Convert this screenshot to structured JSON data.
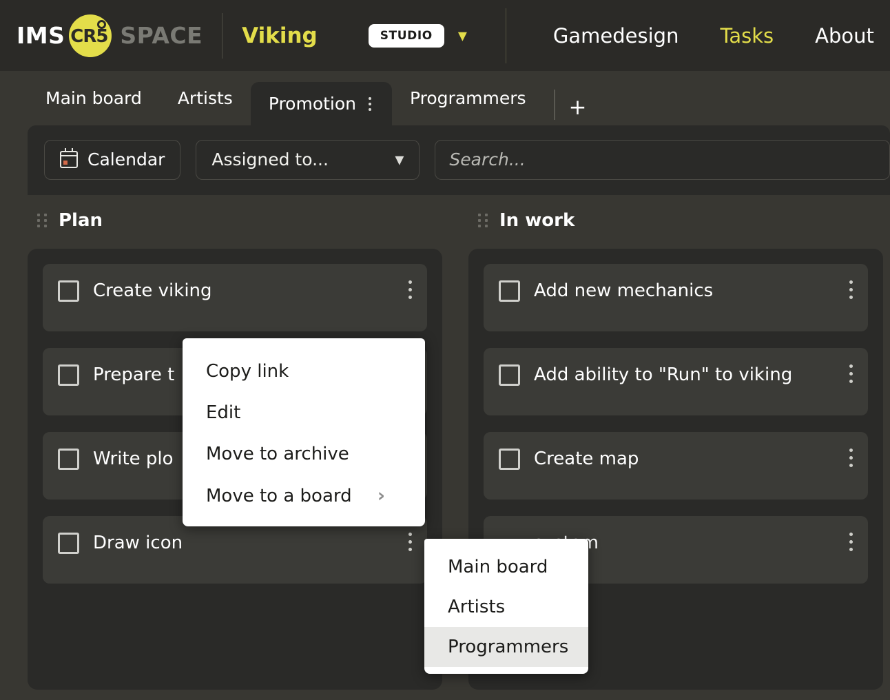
{
  "header": {
    "brand_first": "IMS",
    "brand_logo_text": "CR5",
    "brand_second": "SPACE",
    "project": "Viking",
    "workspace_pill": "STUDIO",
    "workspace_chevron": "chevron-down",
    "nav": [
      {
        "label": "Gamedesign",
        "active": false
      },
      {
        "label": "Tasks",
        "active": true
      },
      {
        "label": "About",
        "active": false
      }
    ],
    "accent_color": "#e3dd4a",
    "bar_color": "#2b2a27"
  },
  "tabs": {
    "items": [
      {
        "label": "Main board",
        "active": false
      },
      {
        "label": "Artists",
        "active": false
      },
      {
        "label": "Promotion",
        "active": true
      },
      {
        "label": "Programmers",
        "active": false
      }
    ],
    "add_label": "+"
  },
  "toolbar": {
    "calendar_label": "Calendar",
    "assigned_label": "Assigned to...",
    "search_placeholder": "Search..."
  },
  "board": {
    "columns": [
      {
        "title": "Plan",
        "cards": [
          {
            "title": "Create viking"
          },
          {
            "title": "Prepare t"
          },
          {
            "title": "Write plo"
          },
          {
            "title": "Draw icon"
          }
        ]
      },
      {
        "title": "In work",
        "cards": [
          {
            "title": "Add new mechanics"
          },
          {
            "title": "Add ability to \"Run\" to viking"
          },
          {
            "title": "Create map"
          },
          {
            "title": "system"
          }
        ]
      }
    ]
  },
  "context_menu": {
    "items": [
      {
        "label": "Copy link",
        "has_submenu": false
      },
      {
        "label": "Edit",
        "has_submenu": false
      },
      {
        "label": "Move to archive",
        "has_submenu": false
      },
      {
        "label": "Move to a board",
        "has_submenu": true
      }
    ],
    "submenu": {
      "items": [
        {
          "label": "Main board",
          "highlighted": false
        },
        {
          "label": "Artists",
          "highlighted": false
        },
        {
          "label": "Programmers",
          "highlighted": true
        }
      ]
    }
  }
}
